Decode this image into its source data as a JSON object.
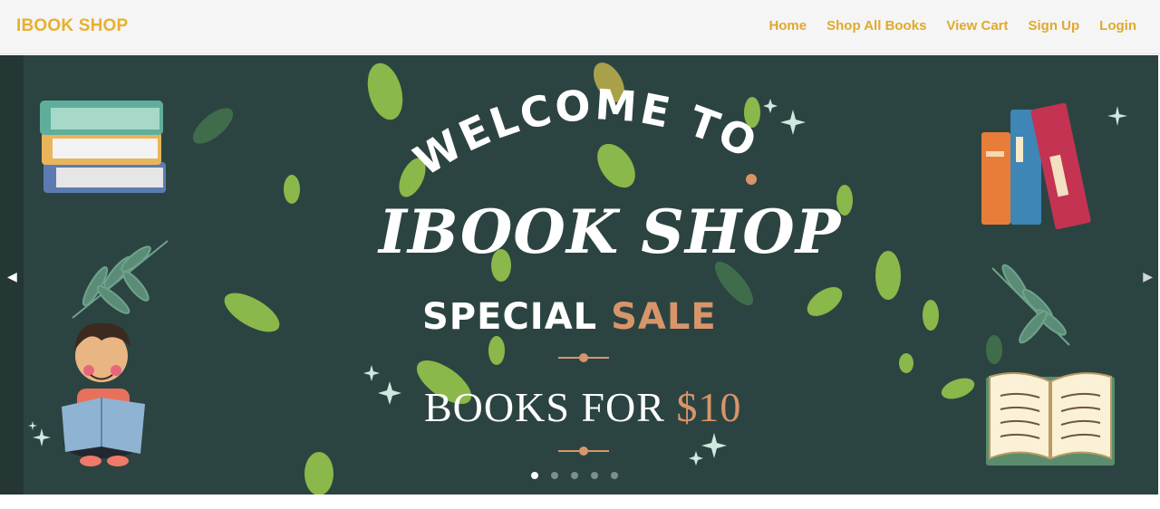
{
  "brand": "IBOOK SHOP",
  "nav": {
    "items": [
      "Home",
      "Shop All Books",
      "View Cart",
      "Sign Up",
      "Login"
    ]
  },
  "banner": {
    "welcome_text": "WELCOME TO",
    "title": "IBOOK SHOP",
    "sale_word1": "SPECIAL",
    "sale_word2": "SALE",
    "price_prefix": "BOOKS FOR",
    "price_value": "$10",
    "slide_count": 5,
    "active_slide": 1
  },
  "controls": {
    "prev_icon": "chevron-left-icon",
    "next_icon": "chevron-right-icon"
  },
  "colors": {
    "brand": "#e8b030",
    "nav_link": "#e0a92c",
    "banner_bg": "#2c4441",
    "accent": "#d8956a",
    "leaf": "#8ab84a"
  }
}
